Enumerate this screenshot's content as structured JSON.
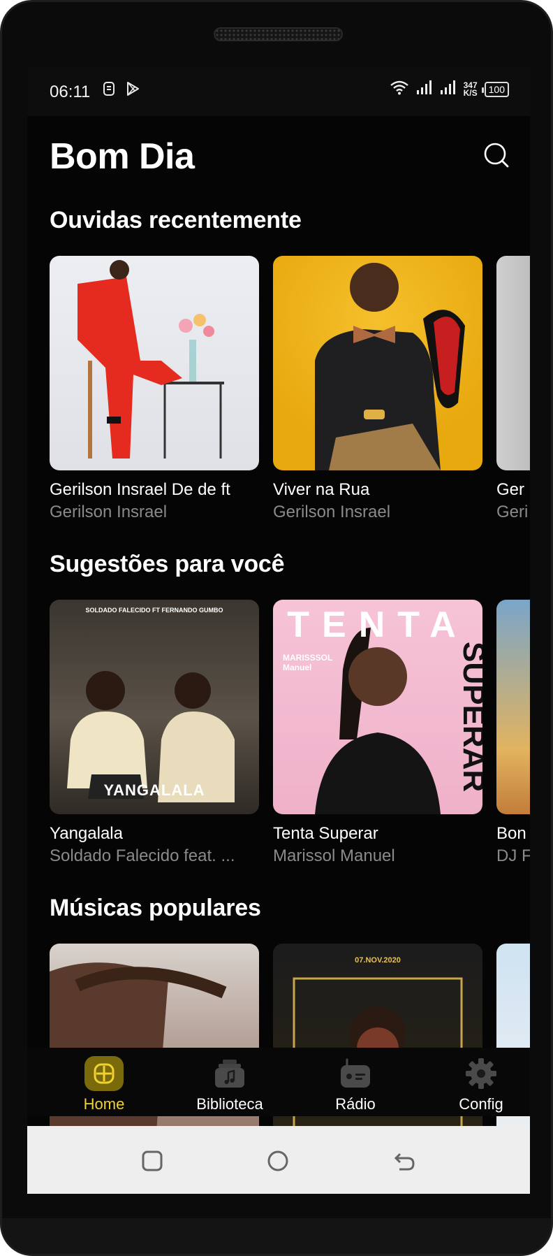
{
  "status_bar": {
    "time": "06:11",
    "net_speed_value": "347",
    "net_speed_unit": "K/S",
    "battery": "100"
  },
  "header": {
    "title": "Bom Dia"
  },
  "sections": [
    {
      "title": "Ouvidas recentemente",
      "cards": [
        {
          "title": " Gerilson Insrael  De de ft",
          "subtitle": "Gerilson Insrael"
        },
        {
          "title": "Viver na Rua",
          "subtitle": "Gerilson Insrael"
        },
        {
          "title": "Ger",
          "subtitle": "Geri"
        }
      ]
    },
    {
      "title": "Sugestões para você",
      "cards": [
        {
          "title": "Yangalala",
          "subtitle": "Soldado Falecido feat. ...",
          "cover_text": "YANGALALA",
          "cover_top_text": "SOLDADO FALECIDO FT FERNANDO GUMBO"
        },
        {
          "title": "Tenta Superar",
          "subtitle": "Marissol Manuel",
          "cover_text": "TENTA",
          "cover_side_text": "SUPERAR",
          "cover_artist": "MARISSSOL Manuel"
        },
        {
          "title": "Bon",
          "subtitle": "DJ F"
        }
      ]
    },
    {
      "title": "Músicas populares",
      "cards": [
        {
          "title": "",
          "subtitle": ""
        },
        {
          "title": "",
          "subtitle": "",
          "cover_text": "07.NOV.2020"
        },
        {
          "title": "",
          "subtitle": ""
        }
      ]
    }
  ],
  "bottom_nav": {
    "items": [
      {
        "label": "Home",
        "icon": "home-icon",
        "active": true
      },
      {
        "label": "Biblioteca",
        "icon": "library-icon",
        "active": false
      },
      {
        "label": "Rádio",
        "icon": "radio-icon",
        "active": false
      },
      {
        "label": "Config",
        "icon": "gear-icon",
        "active": false
      }
    ]
  },
  "colors": {
    "accent": "#f0d230",
    "background": "#050505",
    "muted_text": "#8a8a8a"
  }
}
